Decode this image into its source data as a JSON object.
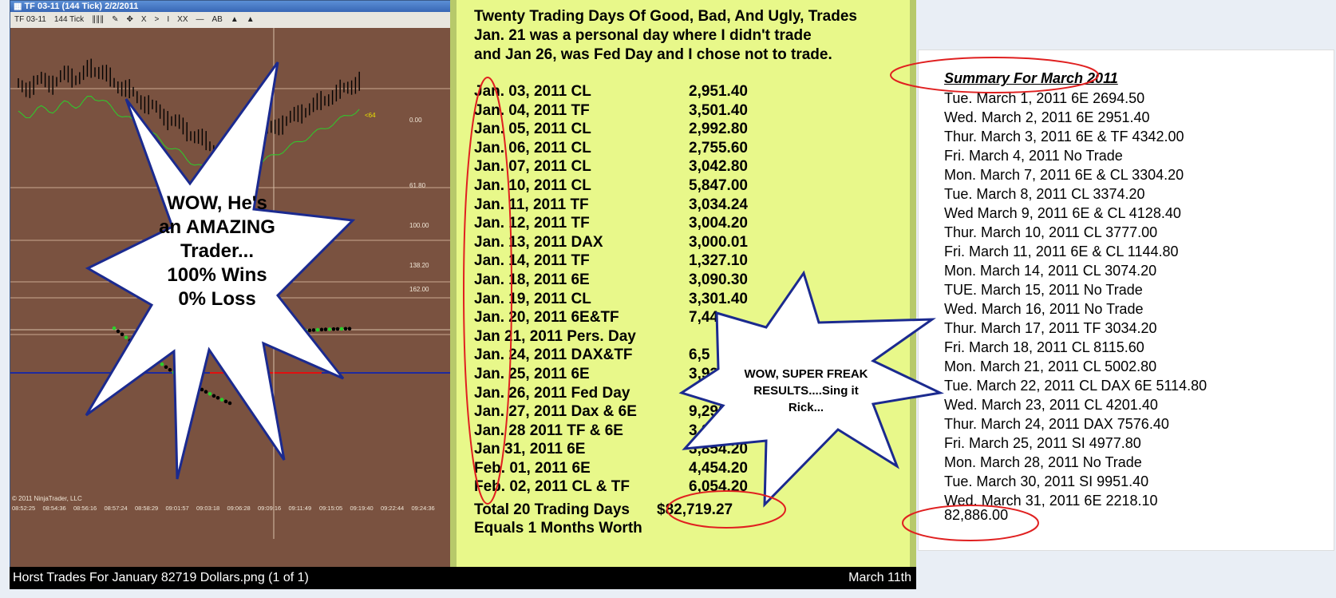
{
  "chart_window": {
    "title": "TF 03-11 (144 Tick)  2/2/2011",
    "toolbar": [
      "TF 03-11",
      "144 Tick",
      "∥∥∥",
      "✎",
      "✥",
      "X",
      ">",
      "I",
      "XX",
      "—",
      "AB",
      "▲",
      "▲"
    ],
    "price_labels": [
      "<64",
      "0.00",
      "61.80",
      "100.00",
      "138.20",
      "162.00"
    ],
    "time_labels": [
      "08:52:25",
      "08:54:36",
      "08:56:16",
      "08:57:24",
      "08:58:29",
      "09:01:57",
      "09:03:18",
      "09:06:28",
      "09:09:16",
      "09:11:49",
      "09:15:05",
      "09:19:40",
      "09:22:44",
      "09:24:36"
    ],
    "copyright": "© 2011 NinjaTrader, LLC",
    "colors": {
      "background": "#7a5240",
      "bar": "#000000",
      "green_line": "#2bd02b",
      "blue_line": "#1e2a9e",
      "red_line": "#e01010"
    }
  },
  "burst_left": {
    "lines": [
      "WOW, He's",
      "an AMAZING",
      "Trader...",
      "100% Wins",
      "0% Loss"
    ]
  },
  "burst_right": {
    "lines": [
      "WOW, SUPER FREAK",
      "RESULTS....Sing it",
      "Rick..."
    ]
  },
  "trades": {
    "heading_lines": [
      "Twenty Trading Days Of Good, Bad, And Ugly, Trades",
      "Jan. 21 was a personal day where I didn't trade",
      "and Jan 26, was Fed Day and I chose not to trade."
    ],
    "rows": [
      {
        "date": "Jan. 03, 2011 CL",
        "amount": "2,951.40"
      },
      {
        "date": "Jan. 04, 2011 TF",
        "amount": "3,501.40"
      },
      {
        "date": "Jan. 05, 2011 CL",
        "amount": "2,992.80"
      },
      {
        "date": "Jan. 06, 2011 CL",
        "amount": "2,755.60"
      },
      {
        "date": "Jan. 07, 2011 CL",
        "amount": "3,042.80"
      },
      {
        "date": "Jan. 10, 2011 CL",
        "amount": "5,847.00"
      },
      {
        "date": "Jan. 11, 2011 TF",
        "amount": "3,034.24"
      },
      {
        "date": "Jan. 12, 2011 TF",
        "amount": "3,004.20"
      },
      {
        "date": "Jan. 13, 2011 DAX",
        "amount": "3,000.01"
      },
      {
        "date": "Jan. 14, 2011 TF",
        "amount": "1,327.10"
      },
      {
        "date": "Jan. 18, 2011 6E",
        "amount": "3,090.30"
      },
      {
        "date": "Jan. 19, 2011 CL",
        "amount": "3,301.40"
      },
      {
        "date": "Jan. 20, 2011 6E&TF",
        "amount": "7,44"
      },
      {
        "date": "Jan  21, 2011 Pers. Day",
        "amount": ""
      },
      {
        "date": "Jan. 24, 2011 DAX&TF",
        "amount": "6,5"
      },
      {
        "date": "Jan. 25, 2011 6E",
        "amount": "3,93"
      },
      {
        "date": "Jan. 26, 2011 Fed Day",
        "amount": ""
      },
      {
        "date": "Jan. 27, 2011 Dax & 6E",
        "amount": "9,290."
      },
      {
        "date": "Jan. 28  2011 TF & 6E",
        "amount": "3,259.60"
      },
      {
        "date": "Jan 31, 2011 6E",
        "amount": "3,854.20"
      },
      {
        "date": "Feb. 01, 2011 6E",
        "amount": "4,454.20"
      },
      {
        "date": "Feb. 02, 2011 CL & TF",
        "amount": "6,054.20"
      }
    ],
    "total_label": "Total 20 Trading Days",
    "total_amount": "$82,719.27",
    "equals_label": "Equals 1 Months Worth"
  },
  "status_bar": {
    "filename": "Horst Trades For January 82719 Dollars.png (1 of 1)",
    "date": "March 11th"
  },
  "summary": {
    "title": "Summary For March 2011",
    "rows": [
      "Tue. March 1, 2011 6E 2694.50",
      "Wed. March 2, 2011 6E 2951.40",
      "Thur. March 3, 2011 6E & TF 4342.00",
      "Fri. March 4, 2011 No Trade",
      "Mon. March 7, 2011 6E & CL 3304.20",
      "Tue. March 8, 2011 CL 3374.20",
      "Wed March 9, 2011 6E & CL 4128.40",
      "Thur. March 10, 2011 CL 3777.00",
      "Fri. March 11, 2011 6E & CL 1144.80",
      "Mon. March 14, 2011 CL 3074.20",
      "TUE. March 15, 2011 No Trade",
      "Wed. March 16, 2011 No Trade",
      "Thur. March 17, 2011 TF 3034.20",
      "Fri. March 18, 2011 CL 8115.60",
      "Mon. March 21, 2011 CL 5002.80",
      "Tue. March 22, 2011 CL DAX 6E 5114.80",
      "Wed. March 23, 2011 CL 4201.40",
      "Thur. March 24, 2011 DAX 7576.40",
      "Fri. March 25, 2011 SI 4977.80",
      "Mon. March 28, 2011 No Trade",
      "Tue. March 30, 2011 SI 9951.40",
      "Wed. March 31, 2011 6E 2218.10"
    ],
    "total": "82,886.00"
  },
  "annotation_color": "#e02020",
  "burst_fill": "#ffffff",
  "burst_stroke": "#1b2a8f"
}
